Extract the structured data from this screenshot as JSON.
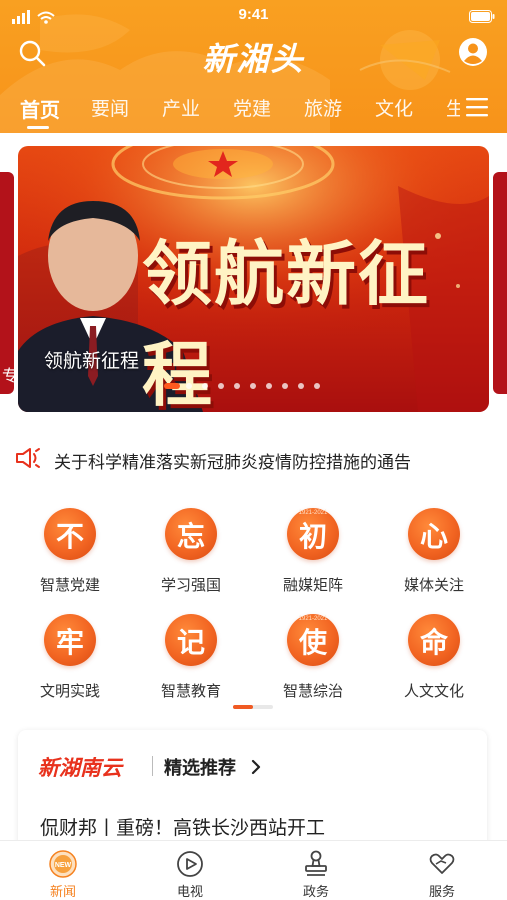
{
  "status_bar": {
    "time": "9:41"
  },
  "header": {
    "logo_text": "新湘头",
    "tabs": [
      {
        "label": "首页",
        "active": true
      },
      {
        "label": "要闻"
      },
      {
        "label": "产业"
      },
      {
        "label": "党建"
      },
      {
        "label": "旅游"
      },
      {
        "label": "文化"
      },
      {
        "label": "生"
      }
    ],
    "colors": {
      "header_bg": "#f7931a",
      "accent": "#f58220"
    }
  },
  "banner": {
    "title": "领航新征程",
    "caption": "领航新征程",
    "side_left_text": "专",
    "slide_count": 10,
    "active_slide": 1
  },
  "notice": {
    "icon": "megaphone-icon",
    "text": "关于科学精准落实新冠肺炎疫情防控措施的通告"
  },
  "grid": [
    {
      "char": "不",
      "mini": "",
      "label": "智慧党建"
    },
    {
      "char": "忘",
      "mini": "",
      "label": "学习强国"
    },
    {
      "char": "初",
      "mini": "1921-2021",
      "label": "融媒矩阵"
    },
    {
      "char": "心",
      "mini": "",
      "label": "媒体关注"
    },
    {
      "char": "牢",
      "mini": "",
      "label": "文明实践"
    },
    {
      "char": "记",
      "mini": "",
      "label": "智慧教育"
    },
    {
      "char": "使",
      "mini": "1921-2021",
      "label": "智慧综治"
    },
    {
      "char": "命",
      "mini": "",
      "label": "人文文化"
    }
  ],
  "recommend": {
    "brand": "新湖南云",
    "title": "精选推荐",
    "news": "侃财邦丨重磅！高铁长沙西站开工"
  },
  "bottom_nav": [
    {
      "label": "新闻",
      "icon": "news-icon",
      "active": true
    },
    {
      "label": "电视",
      "icon": "play-icon"
    },
    {
      "label": "政务",
      "icon": "stamp-icon"
    },
    {
      "label": "服务",
      "icon": "heart-hand-icon"
    }
  ]
}
